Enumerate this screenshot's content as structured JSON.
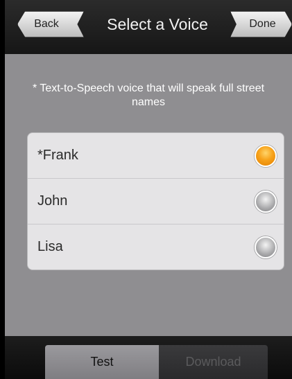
{
  "header": {
    "back_label": "Back",
    "title": "Select a Voice",
    "done_label": "Done"
  },
  "note": "* Text-to-Speech voice that will speak full street names",
  "voices": [
    {
      "label": "*Frank",
      "selected": true
    },
    {
      "label": "John",
      "selected": false
    },
    {
      "label": "Lisa",
      "selected": false
    }
  ],
  "footer": {
    "test_label": "Test",
    "download_label": "Download"
  },
  "colors": {
    "background": "#8f8e91",
    "header": "#1f1f1f",
    "selected_radio": "#f7a21a",
    "list_background": "#e5e4e6"
  }
}
